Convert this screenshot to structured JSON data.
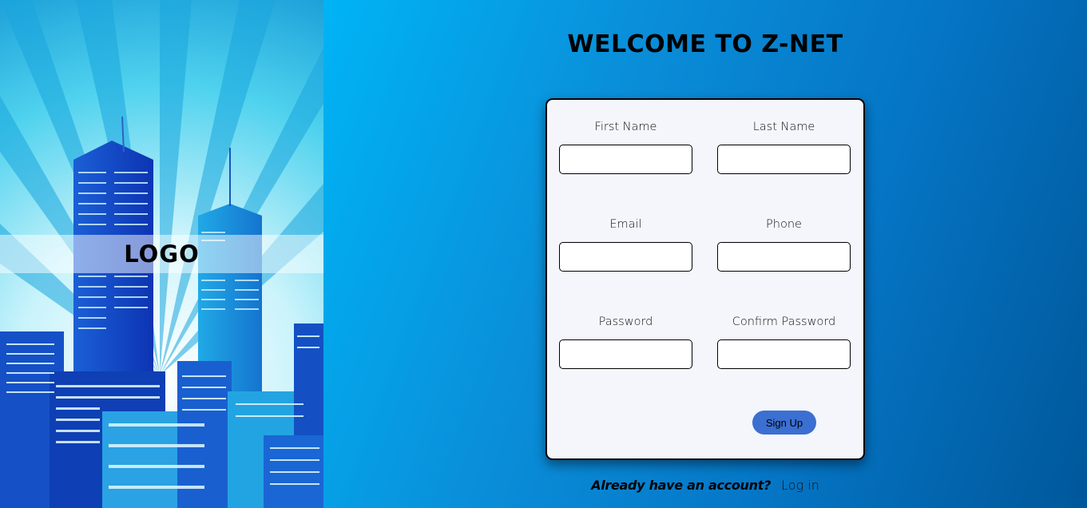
{
  "branding": {
    "logo_text": "LOGO"
  },
  "header": {
    "title": "WELCOME TO Z-NET"
  },
  "form": {
    "fields": [
      {
        "label": "First Name",
        "value": "",
        "placeholder": ""
      },
      {
        "label": "Last Name",
        "value": "",
        "placeholder": ""
      },
      {
        "label": "Email",
        "value": "",
        "placeholder": ""
      },
      {
        "label": "Phone",
        "value": "",
        "placeholder": ""
      },
      {
        "label": "Password",
        "value": "",
        "placeholder": ""
      },
      {
        "label": "Confirm Password",
        "value": "",
        "placeholder": ""
      }
    ],
    "submit_label": "Sign Up"
  },
  "footer": {
    "question": "Already have an account?",
    "link_label": "Log in"
  },
  "colors": {
    "button": "#3b6fd1",
    "card_background": "#f4f6fc",
    "gradient_start": "#00b4f5",
    "gradient_end": "#00579a"
  }
}
